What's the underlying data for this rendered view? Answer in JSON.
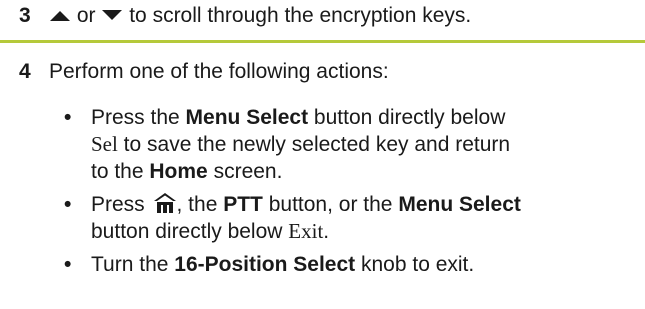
{
  "step3": {
    "number": "3",
    "conj": "or",
    "text": "to scroll through the encryption keys.",
    "up_icon": "up-arrow-icon",
    "down_icon": "down-arrow-icon"
  },
  "divider_color": "#b5c93a",
  "step4": {
    "number": "4",
    "text": "Perform one of the following actions:"
  },
  "bullets": [
    {
      "p1": "Press the ",
      "b1": "Menu Select",
      "p2": " button directly below",
      "serif1": "Sel",
      "p3": " to save the newly selected key and return",
      "p4": "to the ",
      "b2": "Home",
      "p5": " screen."
    },
    {
      "p1": "Press ",
      "icon": "home-icon",
      "p2": ", the ",
      "b1": "PTT",
      "p3": " button, or the ",
      "b2": "Menu Select",
      "p4": "button directly below ",
      "serif1": "Exit",
      "p5": "."
    },
    {
      "p1": "Turn the ",
      "b1": "16-Position Select",
      "p2": " knob to exit."
    }
  ]
}
